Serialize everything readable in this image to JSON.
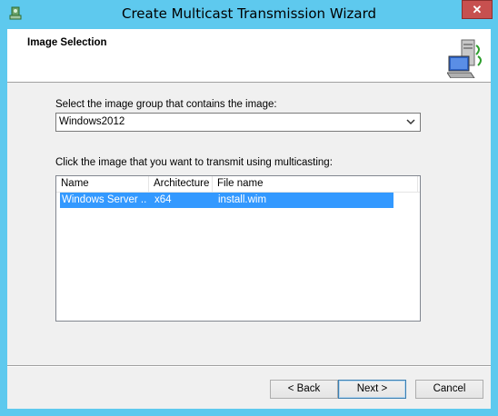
{
  "window": {
    "title": "Create Multicast Transmission Wizard",
    "app_icon": "wds-icon",
    "close_glyph": "✕"
  },
  "header": {
    "title": "Image Selection",
    "icon": "server-multicast-icon"
  },
  "image_group": {
    "label": "Select the image group that contains the image:",
    "selected": "Windows2012"
  },
  "image_list": {
    "label": "Click the image that you want to transmit using multicasting:",
    "columns": [
      "Name",
      "Architecture",
      "File name"
    ],
    "rows": [
      {
        "name": "Windows Server ...",
        "architecture": "x64",
        "file_name": "install.wim",
        "selected": true
      }
    ]
  },
  "buttons": {
    "back": "< Back",
    "next": "Next >",
    "cancel": "Cancel"
  },
  "colors": {
    "title_bar": "#5ec9ee",
    "selection": "#3399ff",
    "close": "#c7504f"
  }
}
